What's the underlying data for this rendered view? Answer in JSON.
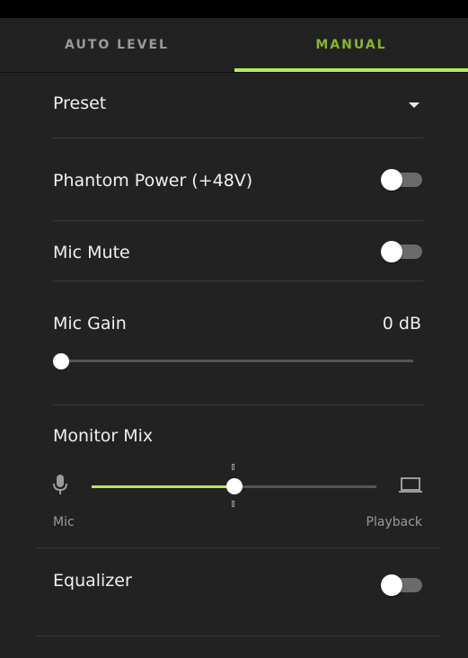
{
  "tabs": [
    {
      "label": "AUTO LEVEL",
      "active": false
    },
    {
      "label": "MANUAL",
      "active": true
    }
  ],
  "colors": {
    "accent": "#b5ec52",
    "accent_text": "#86b52e",
    "background": "#222222"
  },
  "preset": {
    "label": "Preset",
    "icon": "caret-down-icon"
  },
  "phantom_power": {
    "label": "Phantom Power (+48V)",
    "on": false
  },
  "mic_mute": {
    "label": "Mic Mute",
    "on": false
  },
  "mic_gain": {
    "label": "Mic Gain",
    "value_text": "0 dB",
    "level": 0.0
  },
  "monitor_mix": {
    "label": "Monitor Mix",
    "left_label": "Mic",
    "right_label": "Playback",
    "left_icon": "microphone-icon",
    "right_icon": "laptop-icon",
    "level": 0.5
  },
  "equalizer": {
    "label": "Equalizer",
    "on": false
  }
}
